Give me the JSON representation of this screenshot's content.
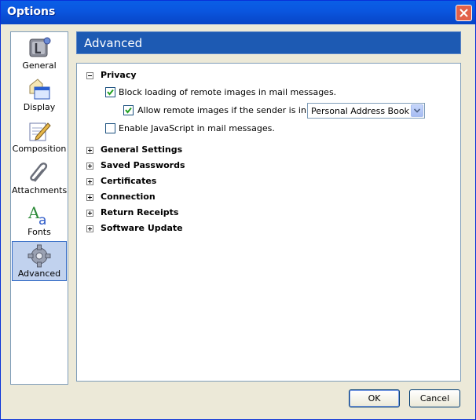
{
  "window": {
    "title": "Options"
  },
  "sidebar": {
    "items": [
      {
        "label": "General",
        "icon": "general-icon",
        "selected": false
      },
      {
        "label": "Display",
        "icon": "display-icon",
        "selected": false
      },
      {
        "label": "Composition",
        "icon": "composition-icon",
        "selected": false
      },
      {
        "label": "Attachments",
        "icon": "paperclip-icon",
        "selected": false
      },
      {
        "label": "Fonts",
        "icon": "fonts-icon",
        "selected": false
      },
      {
        "label": "Advanced",
        "icon": "gear-icon",
        "selected": true
      }
    ]
  },
  "panel": {
    "title": "Advanced",
    "privacy": {
      "heading": "Privacy",
      "expanded": true,
      "block_remote_images": {
        "label": "Block loading of remote images in mail messages.",
        "checked": true
      },
      "allow_remote_images": {
        "label": "Allow remote images if the sender is in my:",
        "checked": true
      },
      "address_book_select": {
        "value": "Personal Address Book"
      },
      "enable_javascript": {
        "label": "Enable JavaScript in mail messages.",
        "checked": false
      }
    },
    "sections": [
      {
        "label": "General Settings",
        "expanded": false
      },
      {
        "label": "Saved Passwords",
        "expanded": false
      },
      {
        "label": "Certificates",
        "expanded": false
      },
      {
        "label": "Connection",
        "expanded": false
      },
      {
        "label": "Return Receipts",
        "expanded": false
      },
      {
        "label": "Software Update",
        "expanded": false
      }
    ]
  },
  "buttons": {
    "ok": "OK",
    "cancel": "Cancel"
  },
  "colors": {
    "titlebar": "#0a57e0",
    "header": "#1d5ab3",
    "selection": "#c1d2ee",
    "close": "#e2614a"
  }
}
